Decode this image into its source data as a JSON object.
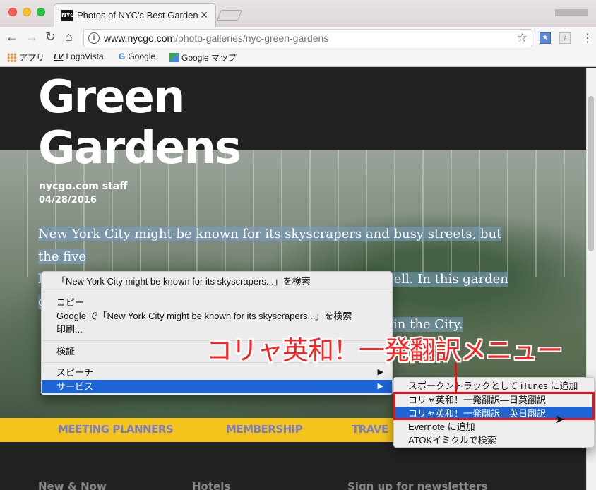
{
  "window": {
    "tab_title": "Photos of NYC's Best Gardens",
    "tab_favicon": "NYC",
    "tab_close_icon": "✕"
  },
  "toolbar": {
    "back_icon": "←",
    "forward_icon": "→",
    "reload_icon": "↻",
    "home_icon": "⌂",
    "url_domain": "www.nycgo.com",
    "url_path": "/photo-galleries/nyc-green-gardens",
    "star_icon": "☆",
    "menu_icon": "⋮"
  },
  "bookmarks": [
    {
      "label": "アプリ",
      "icon": "apps-grid-icon"
    },
    {
      "label": "LogoVista",
      "icon": "lv-icon"
    },
    {
      "label": "Google",
      "icon": "google-icon"
    },
    {
      "label": "Google マップ",
      "icon": "maps-icon"
    }
  ],
  "page": {
    "heading_line1": "Green",
    "heading_line2": "Gardens",
    "author": "nycgo.com staff",
    "date": "04/28/2016",
    "intro_line1": "New York City might be known for its skyscrapers and busy streets, but the five",
    "intro_line2": "boroughs are home to plenty of lush green spaces as well. In this garden gallery,",
    "intro_line3": "ots in the City.",
    "nav": [
      "MEETING PLANNERS",
      "MEMBERSHIP",
      "TRAVE"
    ],
    "footer": [
      "New & Now",
      "Hotels",
      "Sign up for newsletters"
    ]
  },
  "context_menu": {
    "search_selection": "「New York City might be known for its skyscrapers...」を検索",
    "copy": "コピー",
    "search_google": "Google で「New York City might be known for its skyscrapers...」を検索",
    "print": "印刷...",
    "inspect": "検証",
    "speech": "スピーチ",
    "services": "サービス",
    "submenu_arrow": "▶"
  },
  "services_submenu": [
    "スポークントラックとして iTunes に追加",
    "コリャ英和！一発翻訳―日英翻訳",
    "コリャ英和！一発翻訳―英日翻訳",
    "Evernote に追加",
    "ATOKイミクルで検索"
  ],
  "annotation": {
    "callout": "コリャ英和！一発翻訳メニュー",
    "color": "#e81010"
  },
  "colors": {
    "selection": "#1d64d6",
    "nav_bar": "#f5c41c"
  }
}
